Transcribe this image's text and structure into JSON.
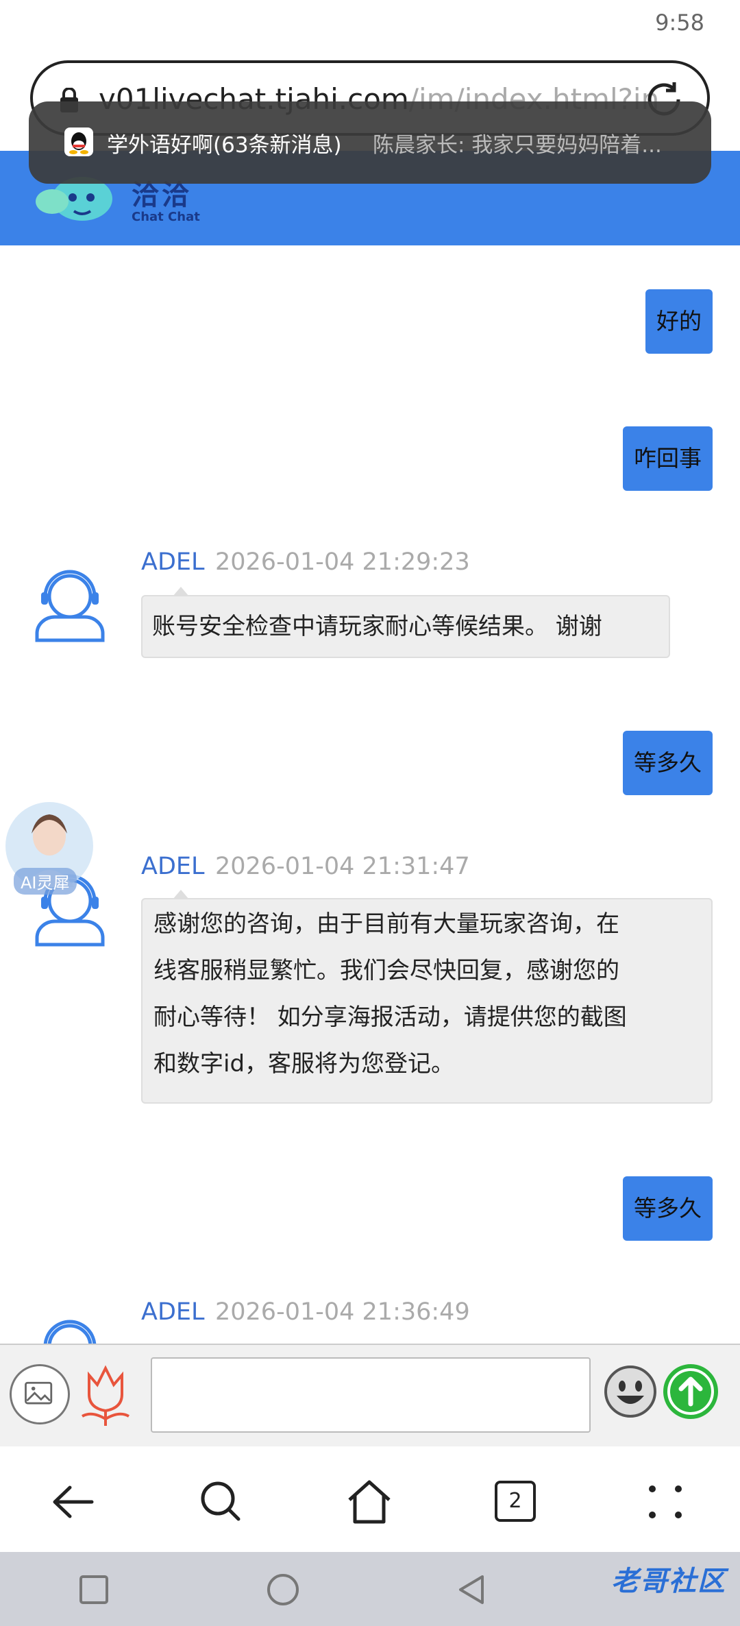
{
  "status_bar": {
    "time": "9:58"
  },
  "address_bar": {
    "url_main": "v01livechat.tjahi.com",
    "url_rest": "/im/index.html?in"
  },
  "notification": {
    "title": "学外语好啊(63条新消息)",
    "message": "陈晨家长: 我家只要妈妈陪着..."
  },
  "app_header": {
    "brand_cn": "洽洽",
    "brand_en": "Chat Chat",
    "bg_color": "#3b82e8"
  },
  "chat": {
    "outgoing": [
      {
        "text": "好的"
      },
      {
        "text": "咋回事"
      },
      {
        "text": "等多久"
      },
      {
        "text": "等多久"
      }
    ],
    "incoming": [
      {
        "name": "ADEL",
        "time": "2026-01-04 21:29:23",
        "text": "账号安全检查中请玩家耐心等候结果。 谢谢"
      },
      {
        "name": "ADEL",
        "time": "2026-01-04 21:31:47",
        "lines": [
          "感谢您的咨询，由于目前有大量玩家咨询，在",
          "线客服稍显繁忙。我们会尽快回复，感谢您的",
          "耐心等待！ 如分享海报活动，请提供您的截图",
          "和数字id，客服将为您登记。"
        ]
      },
      {
        "name": "ADEL",
        "time": "2026-01-04 21:36:49"
      }
    ],
    "ai_assistant_label": "AI灵犀"
  },
  "input_bar": {
    "placeholder": ""
  },
  "browser_nav": {
    "tab_count": "2"
  },
  "watermark": "老哥社区",
  "icons": [
    "lock-icon",
    "reload-icon",
    "qq-icon",
    "agent-avatar-icon",
    "image-icon",
    "flower-icon",
    "emoji-icon",
    "send-icon",
    "back-icon",
    "search-icon",
    "home-icon",
    "tabs-icon",
    "menu-icon",
    "recent-apps-icon",
    "home-circle-icon",
    "back-triangle-icon"
  ]
}
